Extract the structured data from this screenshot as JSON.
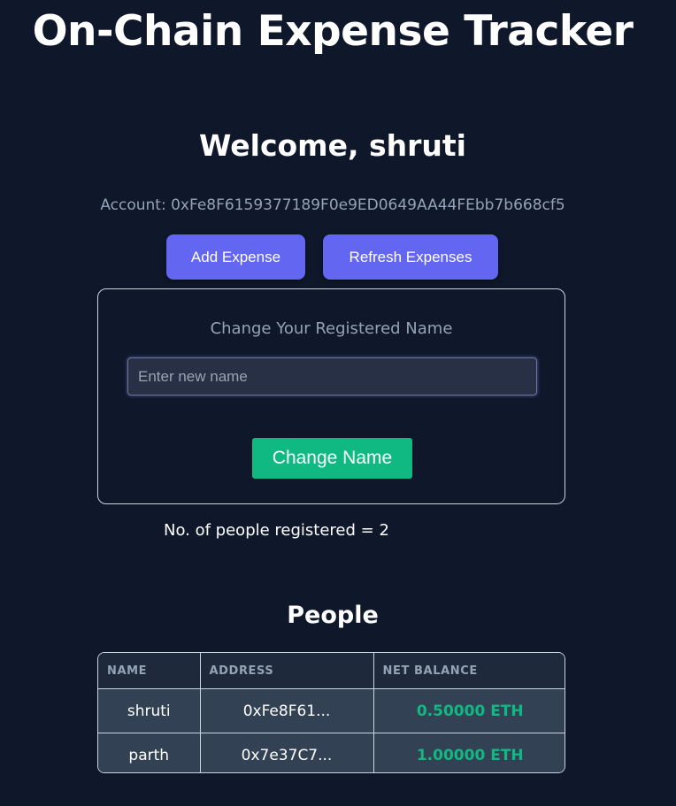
{
  "header": {
    "title": "On-Chain Expense Tracker"
  },
  "welcome": {
    "text": "Welcome, shruti",
    "account": "Account: 0xFe8F6159377189F0e9ED0649AA44FEbb7b668cf5"
  },
  "actions": {
    "add_expense": "Add Expense",
    "refresh_expenses": "Refresh Expenses"
  },
  "change_name": {
    "heading": "Change Your Registered Name",
    "placeholder": "Enter new name",
    "value": "",
    "button": "Change Name"
  },
  "registered": {
    "text": "No. of people registered = 2"
  },
  "people": {
    "heading": "People",
    "columns": [
      "NAME",
      "ADDRESS",
      "NET BALANCE"
    ],
    "rows": [
      {
        "name": "shruti",
        "address": "0xFe8F61...",
        "balance": "0.50000 ETH"
      },
      {
        "name": "parth",
        "address": "0x7e37C7...",
        "balance": "1.00000 ETH"
      }
    ]
  },
  "colors": {
    "background": "#0f172a",
    "primary_button": "#6366f1",
    "success": "#10b981",
    "muted_text": "#94a3b8"
  }
}
